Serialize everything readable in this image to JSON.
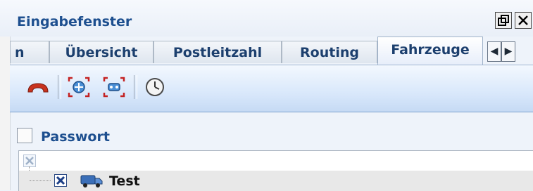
{
  "window": {
    "title": "Eingabefenster",
    "restore_label": "❐",
    "close_label": "✕"
  },
  "tabs": [
    {
      "label": "n"
    },
    {
      "label": "Übersicht"
    },
    {
      "label": "Postleitzahl"
    },
    {
      "label": "Routing"
    },
    {
      "label": "Fahrzeuge",
      "active": true
    }
  ],
  "tab_scroll": {
    "left": "◀",
    "right": "▶"
  },
  "toolbar": {
    "buttons": [
      "hang-up",
      "locate-vehicle",
      "locate-all-vehicles",
      "clock"
    ]
  },
  "password": {
    "label": "Passwort",
    "checked": false
  },
  "tree": {
    "items": [
      {
        "label": "Test",
        "icon": "truck-icon",
        "checked": true
      }
    ]
  },
  "colors": {
    "accent": "#1d4f8f",
    "toolbar": "#d9e8fb"
  }
}
